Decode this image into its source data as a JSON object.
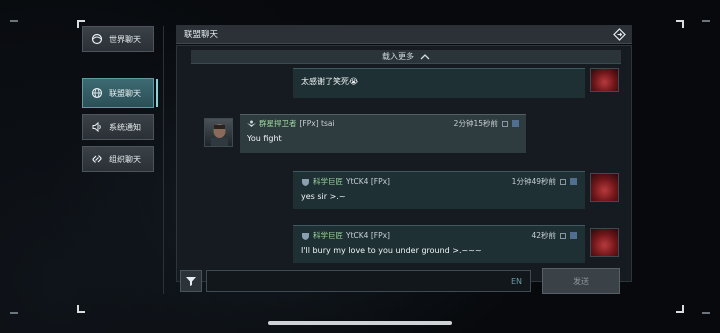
{
  "sidebar": {
    "items": [
      {
        "label": "世界聊天",
        "icon": "globe-swirl-icon",
        "active": false
      },
      {
        "label": "联盟聊天",
        "icon": "globe-icon",
        "active": true
      },
      {
        "label": "系统通知",
        "icon": "speaker-icon",
        "active": false
      },
      {
        "label": "组织聊天",
        "icon": "link-icon",
        "active": false
      }
    ]
  },
  "panel": {
    "title": "联盟聊天",
    "header_icon": "diamond-arrow-icon",
    "load_more": "载入更多"
  },
  "messages": [
    {
      "side": "right",
      "text": "太感谢了笑死😭",
      "avatar": "red-demon-avatar"
    },
    {
      "side": "left",
      "name": "群星捍卫者",
      "tag": "[FPx] tsai",
      "time": "2分钟15秒前",
      "text": "You fight",
      "avatar": "soldier-avatar"
    },
    {
      "side": "right",
      "name": "科学巨匠",
      "tag": "YtCK4 [FPx]",
      "time": "1分钟49秒前",
      "text": "yes sir >.~",
      "avatar": "red-demon-avatar"
    },
    {
      "side": "right",
      "name": "科学巨匠",
      "tag": "YtCK4 [FPx]",
      "time": "42秒前",
      "text": "I'll bury my love to you under ground >.~~~",
      "avatar": "red-demon-avatar"
    }
  ],
  "input": {
    "language": "EN",
    "placeholder": ""
  },
  "send_button": "发送",
  "colors": {
    "accent": "#5f9aa3",
    "name_green": "#9ed89e",
    "bubble_right": "#1f3035"
  }
}
